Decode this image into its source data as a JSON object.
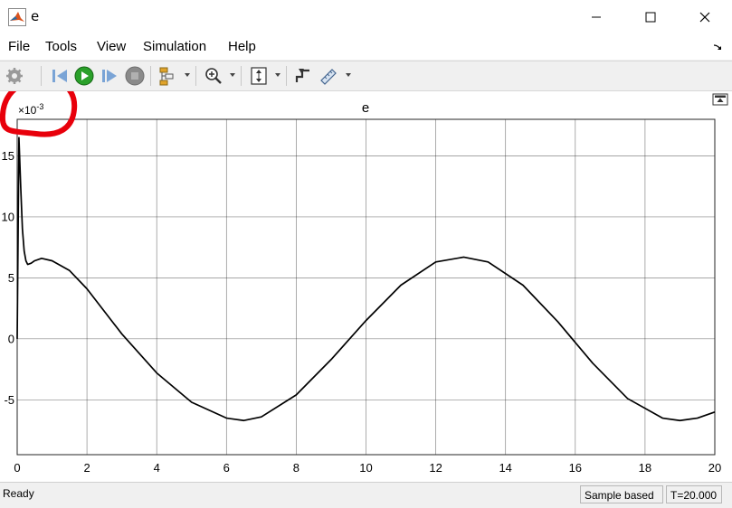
{
  "window": {
    "title": "e",
    "minimize_icon": "minimize-icon",
    "maximize_icon": "maximize-icon",
    "close_icon": "close-icon"
  },
  "menu": {
    "items": [
      "File",
      "Tools",
      "View",
      "Simulation",
      "Help"
    ]
  },
  "toolbar": {
    "icons": [
      "settings-icon",
      "step-back-icon",
      "run-icon",
      "step-forward-icon",
      "stop-icon",
      "signal-selector-icon",
      "zoom-in-icon",
      "fit-to-view-icon",
      "triggers-icon",
      "measurements-icon"
    ]
  },
  "colors": {
    "run": "#2aa02a",
    "stop": "#8a8a8a",
    "annotation": "#e8000b",
    "trace": "#000000",
    "grid": "#262626"
  },
  "chart_data": {
    "type": "line",
    "title": "e",
    "xlabel": "",
    "ylabel": "",
    "exponent_label": "×10",
    "exponent_value": "-3",
    "xlim": [
      0,
      20
    ],
    "ylim": [
      -9.5,
      18
    ],
    "xticks": [
      0,
      2,
      4,
      6,
      8,
      10,
      12,
      14,
      16,
      18,
      20
    ],
    "yticks": [
      -5,
      0,
      5,
      10,
      15
    ],
    "grid": true,
    "series": [
      {
        "x": [
          0.0,
          0.05,
          0.1,
          0.15,
          0.2,
          0.25,
          0.3,
          0.4,
          0.5,
          0.7,
          1.0,
          1.5,
          2.0,
          3.0,
          4.0,
          5.0,
          6.0,
          6.5,
          7.0,
          8.0,
          9.0,
          10.0,
          11.0,
          12.0,
          12.8,
          13.5,
          14.5,
          15.5,
          16.5,
          17.5,
          18.5,
          19.0,
          19.5,
          20.0
        ],
        "y": [
          0.0,
          16.5,
          12.5,
          9.0,
          7.2,
          6.4,
          6.1,
          6.2,
          6.4,
          6.6,
          6.4,
          5.6,
          4.1,
          0.4,
          -2.8,
          -5.2,
          -6.5,
          -6.7,
          -6.4,
          -4.6,
          -1.7,
          1.5,
          4.4,
          6.3,
          6.7,
          6.3,
          4.4,
          1.4,
          -2.0,
          -4.9,
          -6.5,
          -6.7,
          -6.5,
          -6.0
        ]
      }
    ]
  },
  "status": {
    "text": "Ready",
    "sample": "Sample based",
    "time": "T=20.000"
  }
}
